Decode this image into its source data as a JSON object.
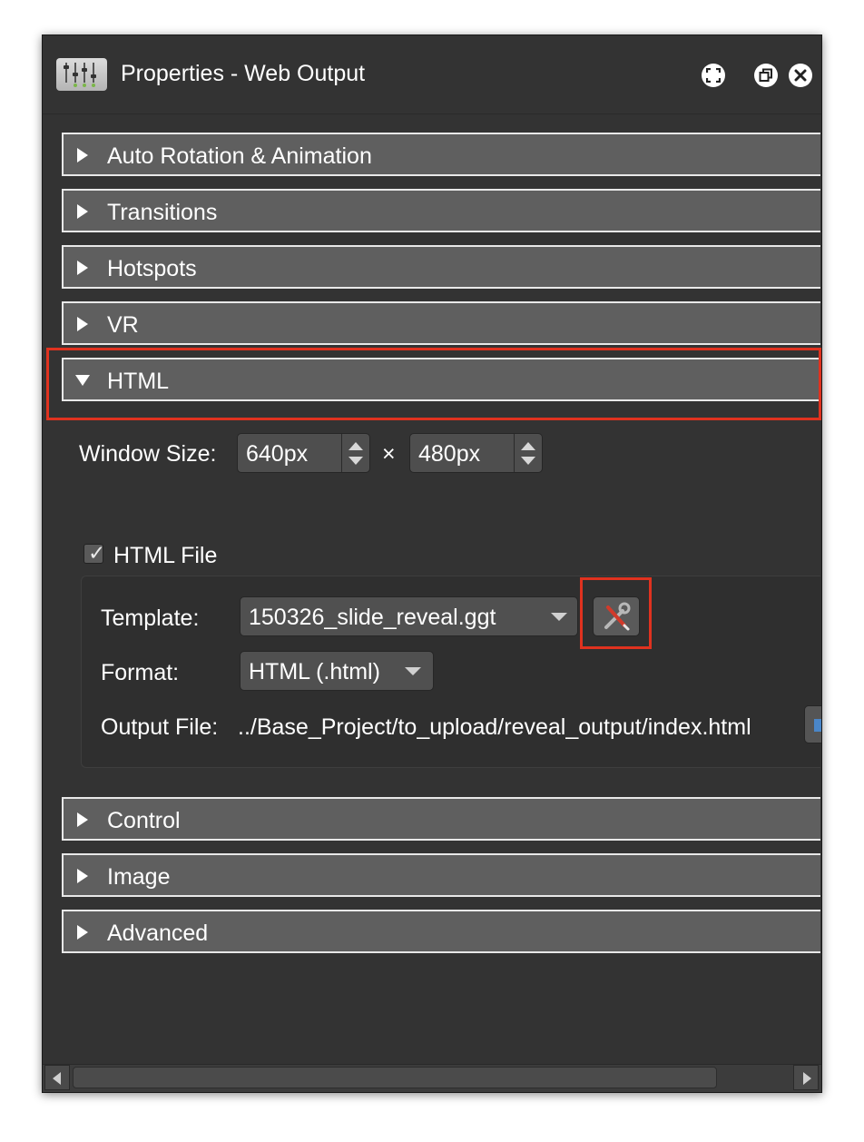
{
  "window": {
    "title": "Properties - Web Output",
    "app_icon": "sliders-icon",
    "buttons": [
      {
        "name": "fullscreen-icon"
      },
      {
        "name": "restore-icon"
      },
      {
        "name": "close-icon"
      }
    ]
  },
  "sections": [
    {
      "label": "Auto Rotation & Animation",
      "expanded": false
    },
    {
      "label": "Transitions",
      "expanded": false
    },
    {
      "label": "Hotspots",
      "expanded": false
    },
    {
      "label": "VR",
      "expanded": false
    },
    {
      "label": "HTML",
      "expanded": true
    },
    {
      "label": "Control",
      "expanded": false
    },
    {
      "label": "Image",
      "expanded": false
    },
    {
      "label": "Advanced",
      "expanded": false
    }
  ],
  "html_section": {
    "window_size_label": "Window Size:",
    "width_value": "640px",
    "times_symbol": "×",
    "height_value": "480px",
    "html_file_label": "HTML File",
    "html_file_checked": true,
    "checkmark": "✓",
    "template_label": "Template:",
    "template_value": "150326_slide_reveal.ggt",
    "template_tool_icon": "wrench-screwdriver-icon",
    "format_label": "Format:",
    "format_value": "HTML (.html)",
    "output_file_label": "Output File:",
    "output_file_value": "../Base_Project/to_upload/reveal_output/index.html"
  },
  "colors": {
    "highlight": "#e0321f",
    "panel": "#333333",
    "section": "#5f5f5f"
  }
}
